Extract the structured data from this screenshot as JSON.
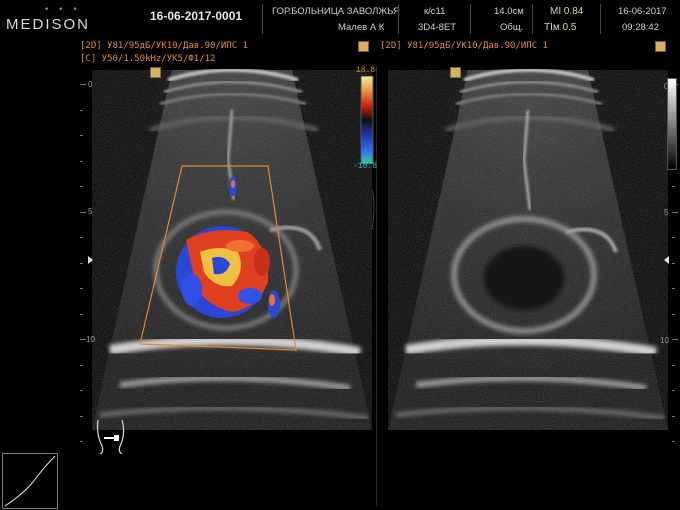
{
  "header": {
    "brand": "MEDISON",
    "patient_id": "16-06-2017-0001",
    "hospital": "ГОР.БОЛЬНИЦА ЗАВОЛЖЬЯ",
    "operator": "Малев А К",
    "probe_line1": "к/с11",
    "probe_line2": "3D4-8ET",
    "depth": "14.0см",
    "preset": "Общ.",
    "mi_label": "MI",
    "mi_value": "0.84",
    "tim_label": "TIм",
    "tim_value": "0.5",
    "date": "16-06-2017",
    "time": "09:28:42"
  },
  "left_panel": {
    "params_2d": "[2D] У81/95дБ/УК10/Дав.90/ИПС 1",
    "params_color": "[C] У50/1.50kHz/УК5/Ф1/12",
    "depth_labels": [
      "0",
      "5",
      "10"
    ],
    "color_scale_top": "18.8",
    "color_scale_bottom": "-18.8"
  },
  "right_panel": {
    "params_2d": "[2D] У81/95дБ/УК10/Дав.90/ИПС 1",
    "depth_labels": [
      "0",
      "5",
      "10"
    ]
  },
  "icons": {
    "gain_icon": "settings-icon",
    "body_mark": "body-mark-icon",
    "tgc": "tgc-curve-icon"
  },
  "colors": {
    "param_text": "#e08a30",
    "roi_box": "#e08a30",
    "doppler_red": "#e04020",
    "doppler_blue": "#2848d8"
  }
}
